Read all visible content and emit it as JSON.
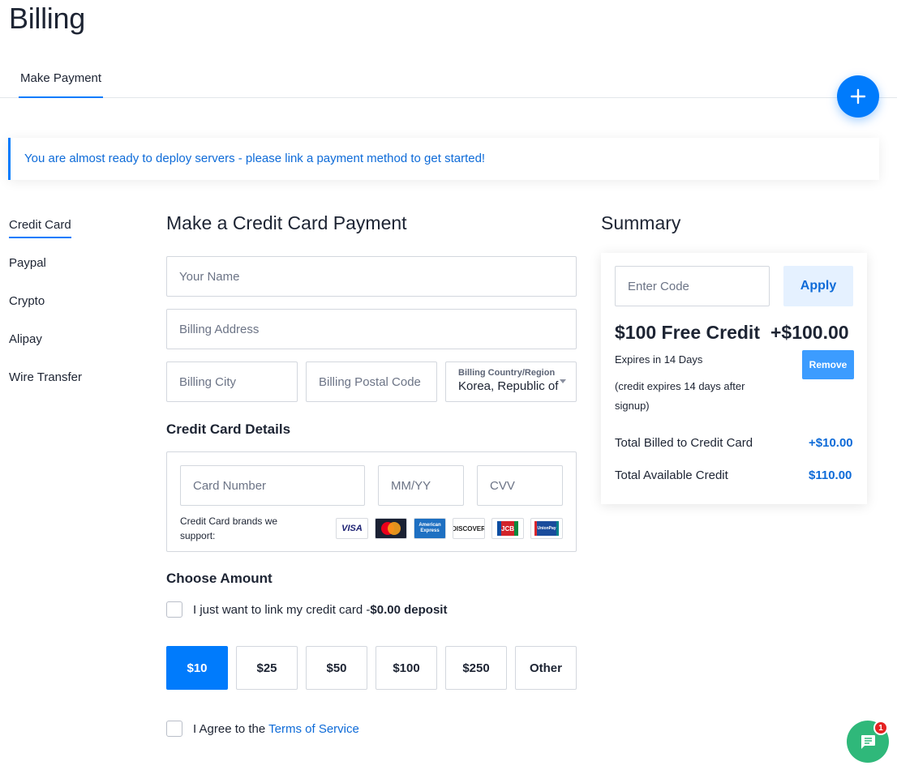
{
  "page": {
    "title": "Billing"
  },
  "tabs": [
    {
      "label": "Make Payment"
    }
  ],
  "notice": {
    "text": "You are almost ready to deploy servers - please link a payment method to get started!"
  },
  "sidenav": {
    "items": [
      {
        "label": "Credit Card"
      },
      {
        "label": "Paypal"
      },
      {
        "label": "Crypto"
      },
      {
        "label": "Alipay"
      },
      {
        "label": "Wire Transfer"
      }
    ]
  },
  "payment": {
    "heading": "Make a Credit Card Payment",
    "name_placeholder": "Your Name",
    "address_placeholder": "Billing Address",
    "city_placeholder": "Billing City",
    "postal_placeholder": "Billing Postal Code",
    "country_label": "Billing Country/Region",
    "country_value": "Korea, Republic of"
  },
  "card": {
    "heading": "Credit Card Details",
    "number_placeholder": "Card Number",
    "expiry_placeholder": "MM/YY",
    "cvv_placeholder": "CVV",
    "brands_text": "Credit Card brands we support:",
    "brands": [
      "VISA",
      "Mastercard",
      "American Express",
      "DISCOVER",
      "JCB",
      "UnionPay"
    ]
  },
  "amount": {
    "heading": "Choose Amount",
    "link_only_label": "I just want to link my credit card -",
    "link_only_bold": "$0.00 deposit",
    "options": [
      "$10",
      "$25",
      "$50",
      "$100",
      "$250",
      "Other"
    ],
    "selected": "$10"
  },
  "terms": {
    "prefix": "I Agree to the ",
    "link": "Terms of Service"
  },
  "summary": {
    "heading": "Summary",
    "code_placeholder": "Enter Code",
    "apply_label": "Apply",
    "credit_title": "$100 Free Credit",
    "credit_amount": "+$100.00",
    "expires": "Expires in 14 Days",
    "note": "(credit expires 14 days after signup)",
    "remove_label": "Remove",
    "billed_label": "Total Billed to Credit Card",
    "billed_value": "+$10.00",
    "available_label": "Total Available Credit",
    "available_value": "$110.00"
  },
  "chat": {
    "badge": "1"
  },
  "colors": {
    "accent": "#007bfc",
    "chat": "#2fb87a",
    "badge": "#e52222"
  }
}
